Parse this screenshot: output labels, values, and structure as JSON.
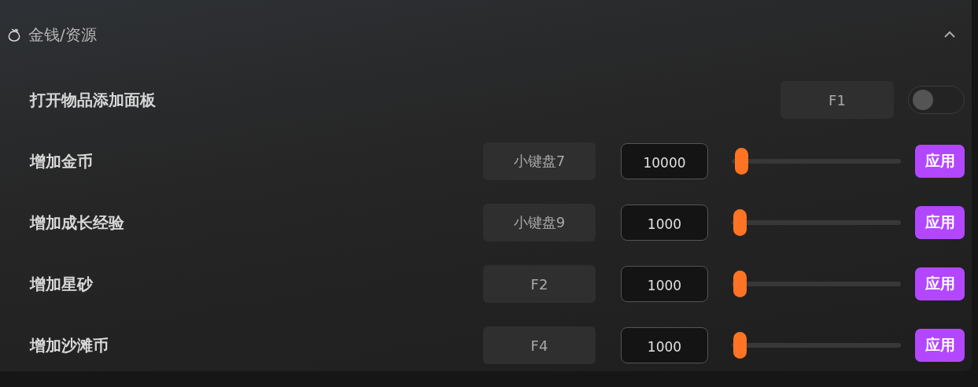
{
  "section": {
    "title": "金钱/资源",
    "expanded": true
  },
  "rows": [
    {
      "kind": "toggle",
      "label": "打开物品添加面板",
      "hotkey": "F1",
      "on": false
    },
    {
      "kind": "slider",
      "label": "增加金币",
      "hotkey": "小键盘7",
      "value": "10000",
      "level": 0.02,
      "button": "应用"
    },
    {
      "kind": "slider",
      "label": "增加成长经验",
      "hotkey": "小键盘9",
      "value": "1000",
      "level": 0.01,
      "button": "应用"
    },
    {
      "kind": "slider",
      "label": "增加星砂",
      "hotkey": "F2",
      "value": "1000",
      "level": 0.01,
      "button": "应用"
    },
    {
      "kind": "slider",
      "label": "增加沙滩币",
      "hotkey": "F4",
      "value": "1000",
      "level": 0.01,
      "button": "应用"
    }
  ]
}
